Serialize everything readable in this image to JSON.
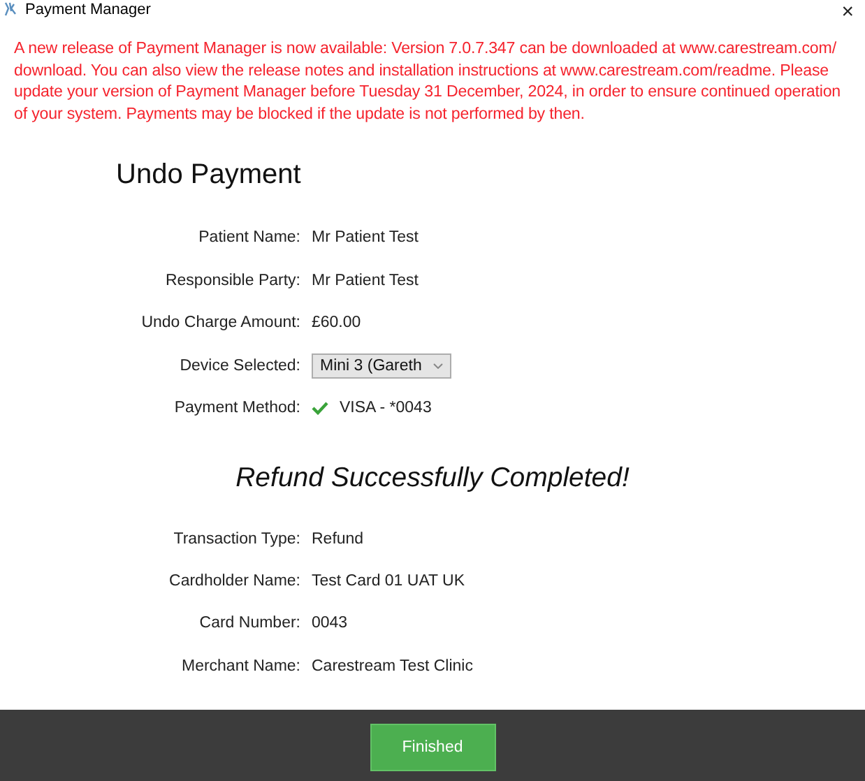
{
  "window": {
    "title": "Payment Manager",
    "close": "×"
  },
  "notice": "A new release of Payment Manager is now available: Version 7.0.7.347 can be downloaded at www.carestream.com/ download. You can also view the release notes and installation instructions at www.carestream.com/readme. Please update your version of Payment Manager before Tuesday 31 December, 2024, in order to ensure continued operation of your system. Payments may be blocked if the update is not performed by then.",
  "heading": "Undo Payment",
  "details": [
    {
      "kind": "text",
      "label": "Patient Name:",
      "value": "Mr Patient Test"
    },
    {
      "kind": "text",
      "label": "Responsible Party:",
      "value": "Mr Patient Test"
    },
    {
      "kind": "text",
      "label": "Undo Charge Amount:",
      "value": "£60.00"
    },
    {
      "kind": "dropdown",
      "label": "Device Selected:",
      "value": "Mini 3 (Gareth"
    },
    {
      "kind": "verified",
      "label": "Payment Method:",
      "value": "VISA - *0043"
    }
  ],
  "result": "Refund Successfully Completed!",
  "transaction": [
    {
      "label": "Transaction Type:",
      "value": "Refund"
    },
    {
      "label": "Cardholder Name:",
      "value": "Test Card 01 UAT UK"
    },
    {
      "label": "Card Number:",
      "value": "0043"
    },
    {
      "label": "Merchant Name:",
      "value": "Carestream Test Clinic"
    }
  ],
  "footer": {
    "button": "Finished"
  }
}
